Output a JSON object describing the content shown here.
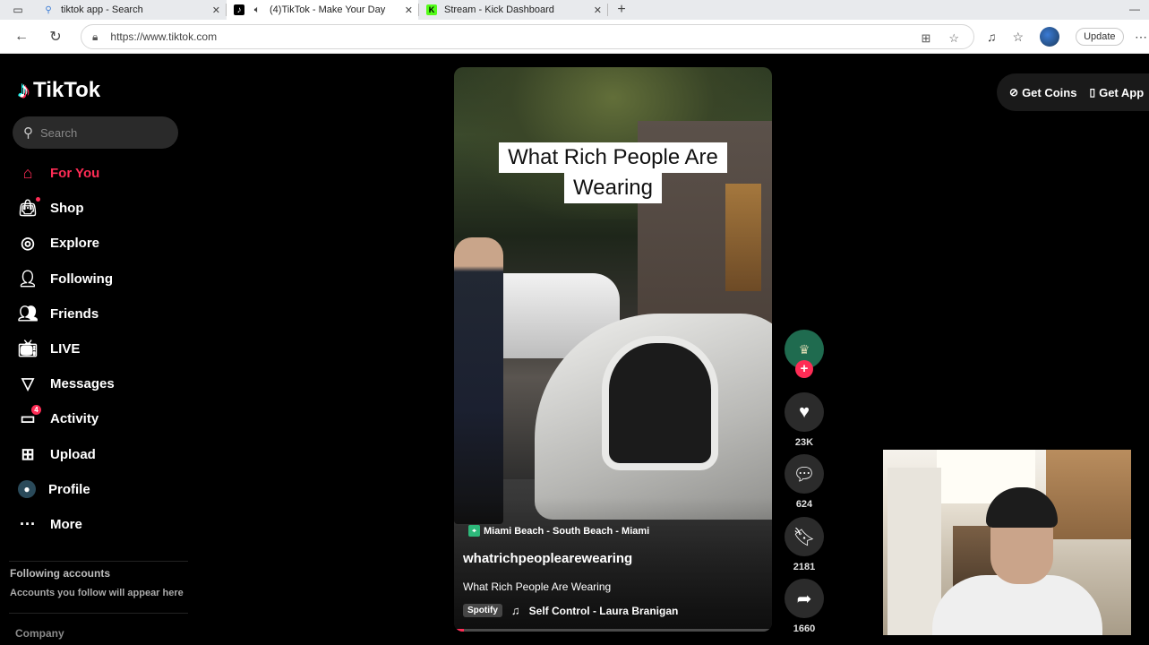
{
  "browser": {
    "tabs": [
      {
        "title": "tiktok app - Search",
        "icon": "search-icon",
        "active": false
      },
      {
        "title": "(4)TikTok - Make Your Day",
        "icon": "tiktok-icon",
        "active": true
      },
      {
        "title": "Stream - Kick Dashboard",
        "icon": "kick-icon",
        "active": false
      }
    ],
    "new_tab": "+",
    "url": "https://www.tiktok.com",
    "update_label": "Update"
  },
  "tiktok": {
    "logo": "TikTok",
    "search_placeholder": "Search",
    "nav": [
      {
        "label": "For You",
        "icon": "home-icon",
        "active": true
      },
      {
        "label": "Shop",
        "icon": "shopping-bag-icon"
      },
      {
        "label": "Explore",
        "icon": "compass-icon"
      },
      {
        "label": "Following",
        "icon": "user-follow-icon"
      },
      {
        "label": "Friends",
        "icon": "friends-icon"
      },
      {
        "label": "LIVE",
        "icon": "live-tv-icon"
      },
      {
        "label": "Messages",
        "icon": "send-icon"
      },
      {
        "label": "Activity",
        "icon": "activity-icon",
        "badge": "4"
      },
      {
        "label": "Upload",
        "icon": "upload-icon"
      },
      {
        "label": "Profile",
        "icon": "profile-avatar-icon"
      },
      {
        "label": "More",
        "icon": "more-dots-icon"
      }
    ],
    "following_title": "Following accounts",
    "following_sub": "Accounts you follow will appear here",
    "company": "Company",
    "top_right": {
      "get_coins": "Get Coins",
      "get_app": "Get App"
    }
  },
  "video": {
    "caption_line1": "What Rich People Are",
    "caption_line2": "Wearing",
    "location": "Miami Beach - South Beach - Miami",
    "author": "whatrichpeoplearewearing",
    "description": "What Rich People Are Wearing",
    "music_source": "Spotify",
    "music": "Self Control - Laura Branigan",
    "progress": 0.03
  },
  "actions": {
    "likes": "23K",
    "comments": "624",
    "saves": "2181",
    "shares": "1660"
  },
  "colors": {
    "accent": "#fe2c55",
    "background": "#000000"
  }
}
